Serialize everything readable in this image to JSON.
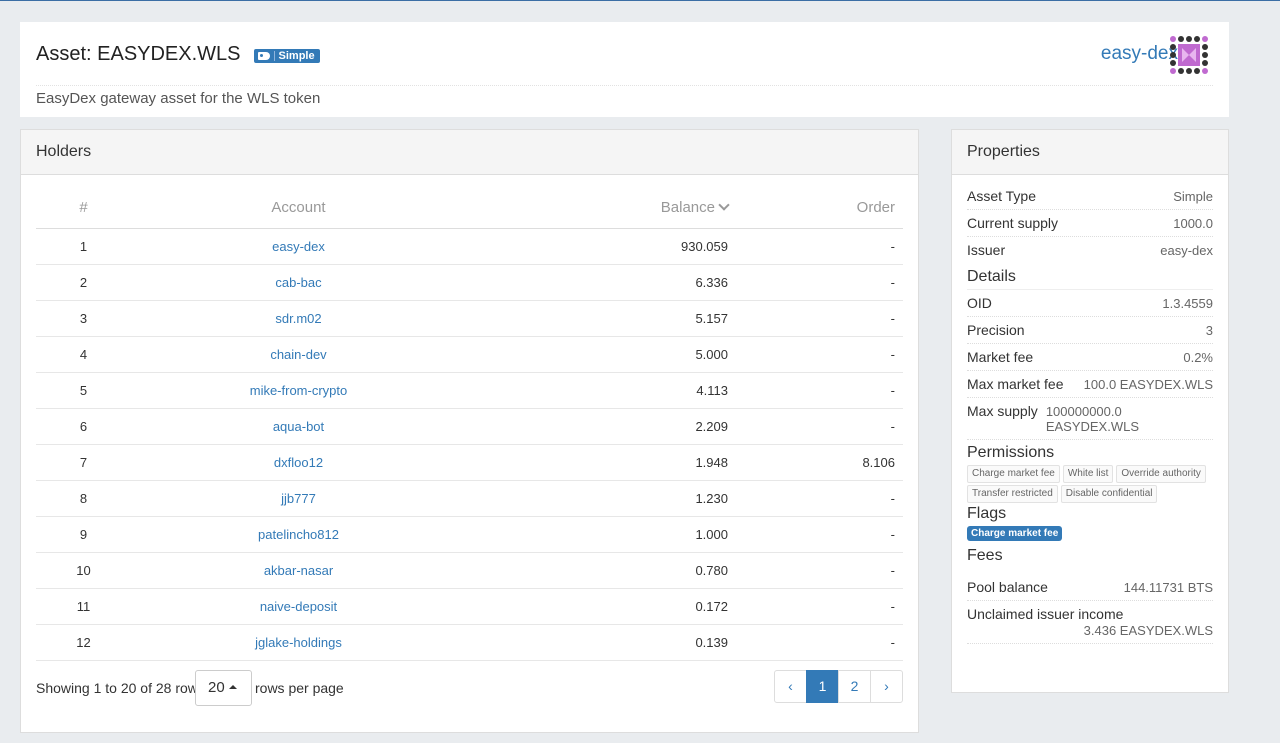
{
  "asset": {
    "title": "Asset: EASYDEX.WLS",
    "type_badge": "Simple",
    "description": "EasyDex gateway asset for the WLS token",
    "issuer_link": "easy-dex"
  },
  "holders": {
    "heading": "Holders",
    "columns": {
      "rank": "#",
      "account": "Account",
      "balance": "Balance",
      "order": "Order"
    },
    "rows": [
      {
        "rank": "1",
        "account": "easy-dex",
        "balance": "930.059",
        "order": "-"
      },
      {
        "rank": "2",
        "account": "cab-bac",
        "balance": "6.336",
        "order": "-"
      },
      {
        "rank": "3",
        "account": "sdr.m02",
        "balance": "5.157",
        "order": "-"
      },
      {
        "rank": "4",
        "account": "chain-dev",
        "balance": "5.000",
        "order": "-"
      },
      {
        "rank": "5",
        "account": "mike-from-crypto",
        "balance": "4.113",
        "order": "-"
      },
      {
        "rank": "6",
        "account": "aqua-bot",
        "balance": "2.209",
        "order": "-"
      },
      {
        "rank": "7",
        "account": "dxfloo12",
        "balance": "1.948",
        "order": "8.106"
      },
      {
        "rank": "8",
        "account": "jjb777",
        "balance": "1.230",
        "order": "-"
      },
      {
        "rank": "9",
        "account": "patelincho812",
        "balance": "1.000",
        "order": "-"
      },
      {
        "rank": "10",
        "account": "akbar-nasar",
        "balance": "0.780",
        "order": "-"
      },
      {
        "rank": "11",
        "account": "naive-deposit",
        "balance": "0.172",
        "order": "-"
      },
      {
        "rank": "12",
        "account": "jglake-holdings",
        "balance": "0.139",
        "order": "-"
      }
    ],
    "pagination": {
      "showing": "Showing 1 to 20 of 28 rows",
      "page_size": "20",
      "rows_per_page": "rows per page",
      "prev": "‹",
      "pages": [
        "1",
        "2"
      ],
      "next": "›"
    }
  },
  "properties": {
    "heading": "Properties",
    "asset_type_label": "Asset Type",
    "asset_type": "Simple",
    "current_supply_label": "Current supply",
    "current_supply": "1000.0",
    "issuer_label": "Issuer",
    "issuer": "easy-dex",
    "details_title": "Details",
    "oid_label": "OID",
    "oid": "1.3.4559",
    "precision_label": "Precision",
    "precision": "3",
    "market_fee_label": "Market fee",
    "market_fee": "0.2%",
    "max_market_fee_label": "Max market fee",
    "max_market_fee": "100.0 EASYDEX.WLS",
    "max_supply_label": "Max supply",
    "max_supply_line1": "100000000.0",
    "max_supply_line2": "EASYDEX.WLS",
    "permissions_title": "Permissions",
    "permissions": [
      "Charge market fee",
      "White list",
      "Override authority",
      "Transfer restricted",
      "Disable confidential"
    ],
    "flags_title": "Flags",
    "flags": [
      "Charge market fee"
    ],
    "fees_title": "Fees",
    "pool_balance_label": "Pool balance",
    "pool_balance": "144.11731 BTS",
    "unclaimed_label": "Unclaimed issuer income",
    "unclaimed": "3.436 EASYDEX.WLS"
  },
  "colors": {
    "accent": "#337ab7",
    "avatar": "#c06ad0"
  }
}
